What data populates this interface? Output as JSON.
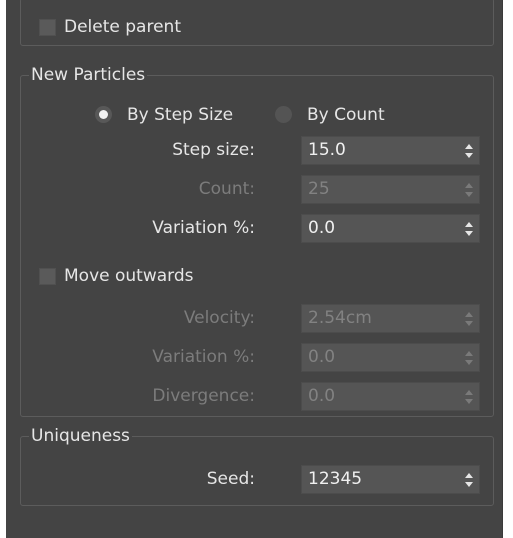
{
  "top": {
    "delete_parent_label": "Delete parent",
    "delete_parent_checked": false
  },
  "new_particles": {
    "legend": "New Particles",
    "radio_by_step_size": "By Step Size",
    "radio_by_count": "By Count",
    "selected_mode": "By Step Size",
    "step_size_label": "Step size:",
    "step_size_value": "15.0",
    "count_label": "Count:",
    "count_value": "25",
    "variation_label": "Variation %:",
    "variation_value": "0.0",
    "move_outwards_label": "Move outwards",
    "move_outwards_checked": false,
    "velocity_label": "Velocity:",
    "velocity_value": "2.54cm",
    "velocity_variation_label": "Variation %:",
    "velocity_variation_value": "0.0",
    "divergence_label": "Divergence:",
    "divergence_value": "0.0"
  },
  "uniqueness": {
    "legend": "Uniqueness",
    "seed_label": "Seed:",
    "seed_value": "12345"
  },
  "colors": {
    "panel_bg": "#444444",
    "text": "#e6e6e6",
    "disabled_text": "#7c7c7c",
    "field_bg": "#555555"
  },
  "icons": {
    "spinner": "spinner-arrows-icon",
    "radio": "radio-dot-icon"
  }
}
